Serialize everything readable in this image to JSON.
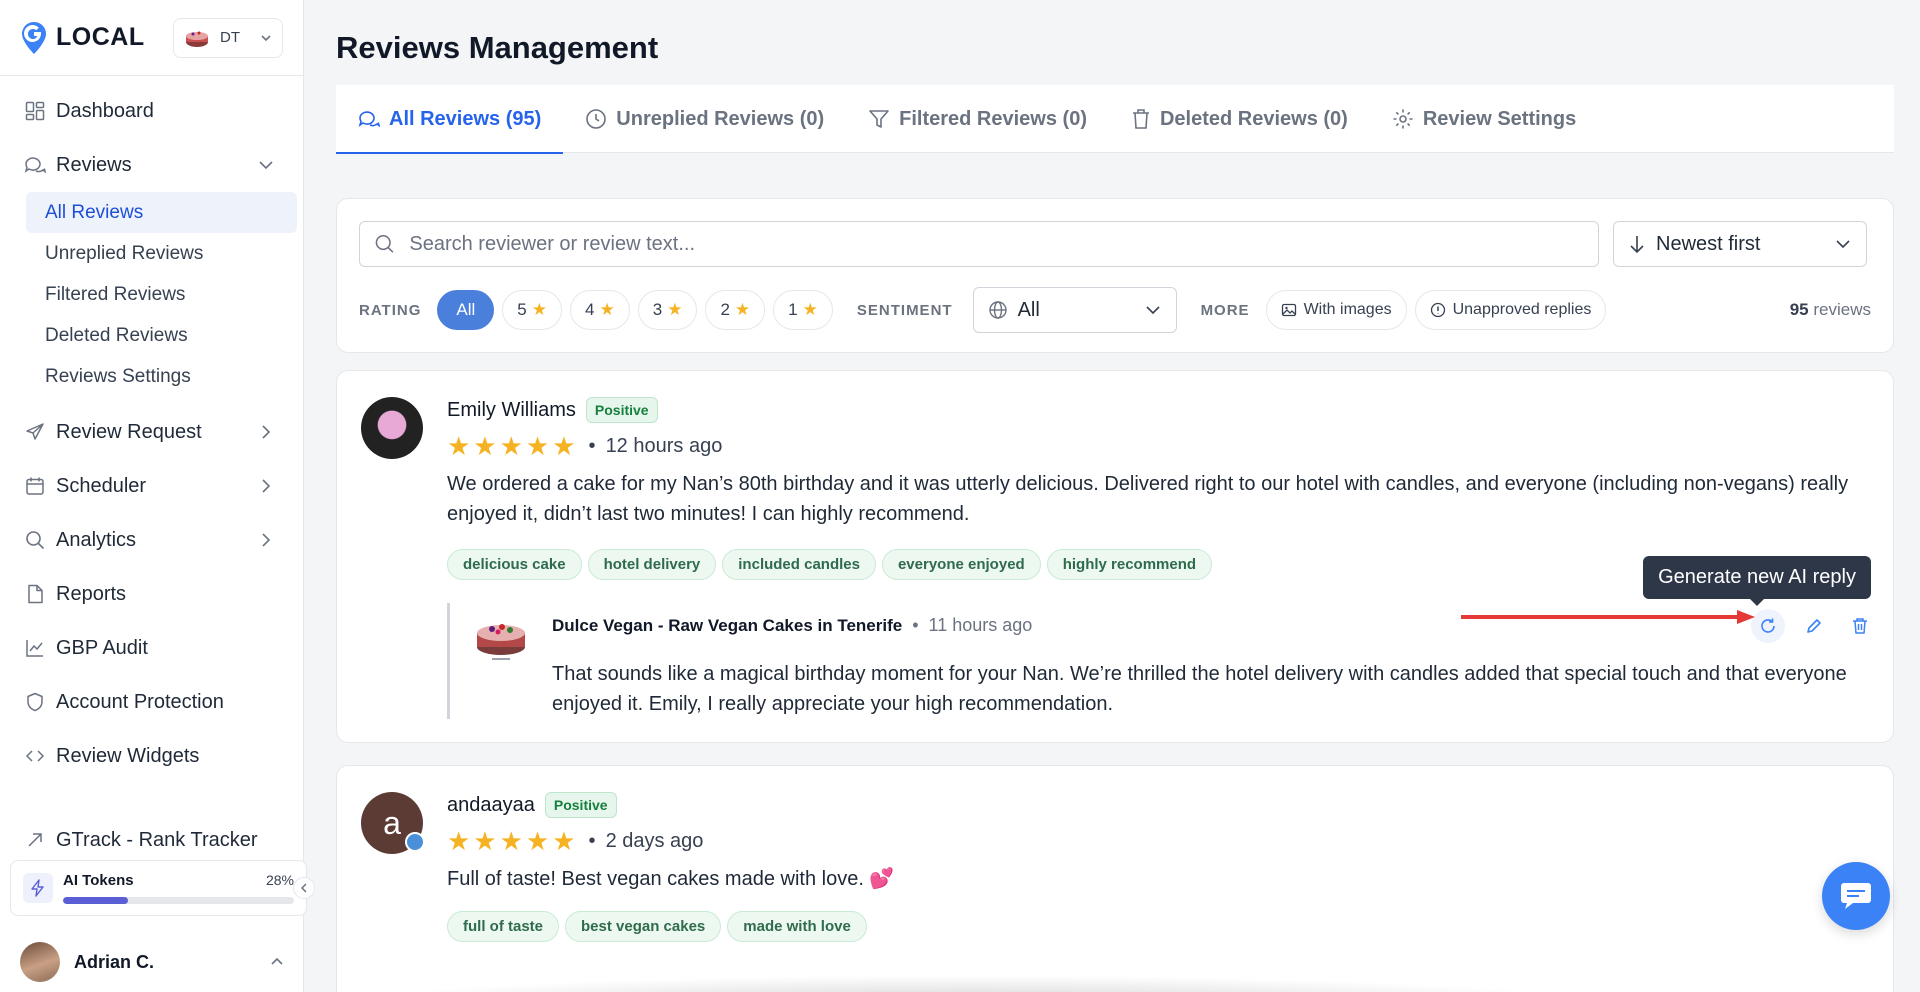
{
  "app": {
    "logo_text": "LOCAL",
    "business_initials": "DT"
  },
  "sidebar": {
    "items": [
      {
        "label": "Dashboard"
      },
      {
        "label": "Reviews"
      },
      {
        "label": "Review Request"
      },
      {
        "label": "Scheduler"
      },
      {
        "label": "Analytics"
      },
      {
        "label": "Reports"
      },
      {
        "label": "GBP Audit"
      },
      {
        "label": "Account Protection"
      },
      {
        "label": "Review Widgets"
      },
      {
        "label": "GTrack - Rank Tracker"
      }
    ],
    "sub_items": [
      {
        "label": "All Reviews"
      },
      {
        "label": "Unreplied Reviews"
      },
      {
        "label": "Filtered Reviews"
      },
      {
        "label": "Deleted Reviews"
      },
      {
        "label": "Reviews Settings"
      }
    ],
    "tokens": {
      "label": "AI Tokens",
      "percent_text": "28%",
      "percent": 28
    },
    "user": {
      "name": "Adrian C."
    }
  },
  "page": {
    "title": "Reviews Management"
  },
  "tabs": [
    {
      "label": "All Reviews (95)"
    },
    {
      "label": "Unreplied Reviews (0)"
    },
    {
      "label": "Filtered Reviews (0)"
    },
    {
      "label": "Deleted Reviews (0)"
    },
    {
      "label": "Review Settings"
    }
  ],
  "filters": {
    "search_placeholder": "Search reviewer or review text...",
    "sort_label": "Newest first",
    "rating_label": "RATING",
    "rating_options": [
      "All",
      "5",
      "4",
      "3",
      "2",
      "1"
    ],
    "sentiment_label": "SENTIMENT",
    "sentiment_value": "All",
    "more_label": "MORE",
    "with_images": "With images",
    "unapproved": "Unapproved replies",
    "count_number": "95",
    "count_suffix": "reviews"
  },
  "reviews": [
    {
      "name": "Emily Williams",
      "sentiment": "Positive",
      "stars": "★★★★★",
      "time": "12 hours ago",
      "text": "We ordered a cake for my Nan’s 80th birthday and it was utterly delicious. Delivered right to our hotel with candles, and everyone (including non-vegans) really enjoyed it, didn’t last two minutes! I can highly recommend.",
      "tags": [
        "delicious cake",
        "hotel delivery",
        "included candles",
        "everyone enjoyed",
        "highly recommend"
      ],
      "reply": {
        "business": "Dulce Vegan - Raw Vegan Cakes in Tenerife",
        "time": "11 hours ago",
        "text": "That sounds like a magical birthday moment for your Nan. We’re thrilled the hotel delivery with candles added that special touch and that everyone enjoyed it. Emily, I really appreciate your high recommendation.",
        "tooltip": "Generate new AI reply"
      }
    },
    {
      "name": "andaayaa",
      "initial": "a",
      "sentiment": "Positive",
      "stars": "★★★★★",
      "time": "2 days ago",
      "text": "Full of taste! Best vegan cakes made with love. 💕",
      "tags": [
        "full of taste",
        "best vegan cakes",
        "made with love"
      ]
    }
  ],
  "colors": {
    "accent": "#2563eb",
    "star": "#f5b324",
    "positive": "#15803d",
    "arrow": "#e53935"
  }
}
